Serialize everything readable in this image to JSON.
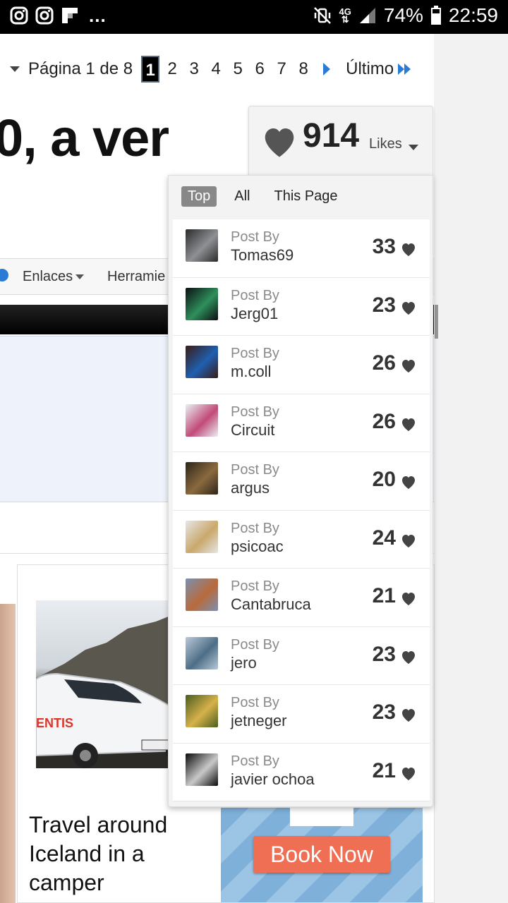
{
  "status_bar": {
    "left_icons": [
      "instagram-icon",
      "instagram-icon",
      "flipboard-icon"
    ],
    "more": "...",
    "network": "4G",
    "battery": "74%",
    "time": "22:59"
  },
  "pager": {
    "label": "Página 1 de 8",
    "pages": [
      "1",
      "2",
      "3",
      "4",
      "5",
      "6",
      "7",
      "8"
    ],
    "active_page": "1",
    "last_label": "Último"
  },
  "thread_title_fragment": "0, a ver",
  "nav": {
    "items": [
      {
        "label": "Enlaces"
      },
      {
        "label": "Herramie"
      }
    ]
  },
  "ad": {
    "text": "Travel around Iceland in a camper",
    "cta": "Book Now"
  },
  "likes": {
    "count": "914",
    "label": "Likes",
    "tabs": [
      "Top",
      "All",
      "This Page"
    ],
    "active_tab": "Top",
    "post_by_label": "Post By",
    "entries": [
      {
        "user": "Tomas69",
        "count": "33",
        "avatar_colors": [
          "#2b2b2b",
          "#8e9094"
        ]
      },
      {
        "user": "Jerg01",
        "count": "23",
        "avatar_colors": [
          "#0b0f14",
          "#2e8f5b"
        ]
      },
      {
        "user": "m.coll",
        "count": "26",
        "avatar_colors": [
          "#3a1c14",
          "#1f5fb0"
        ]
      },
      {
        "user": "Circuit",
        "count": "26",
        "avatar_colors": [
          "#e9f0f5",
          "#c24a78"
        ]
      },
      {
        "user": "argus",
        "count": "20",
        "avatar_colors": [
          "#2d2418",
          "#8a6a3f"
        ]
      },
      {
        "user": "psicoac",
        "count": "24",
        "avatar_colors": [
          "#e6e6e6",
          "#c9a86b"
        ]
      },
      {
        "user": "Cantabruca",
        "count": "21",
        "avatar_colors": [
          "#7a90b0",
          "#b86a3b"
        ]
      },
      {
        "user": "jero",
        "count": "23",
        "avatar_colors": [
          "#b9c8d6",
          "#4d6e86"
        ]
      },
      {
        "user": "jetneger",
        "count": "23",
        "avatar_colors": [
          "#4a5d1f",
          "#d6b24a"
        ]
      },
      {
        "user": "javier ochoa",
        "count": "21",
        "avatar_colors": [
          "#0a0a0a",
          "#c9c9c9"
        ]
      }
    ]
  }
}
